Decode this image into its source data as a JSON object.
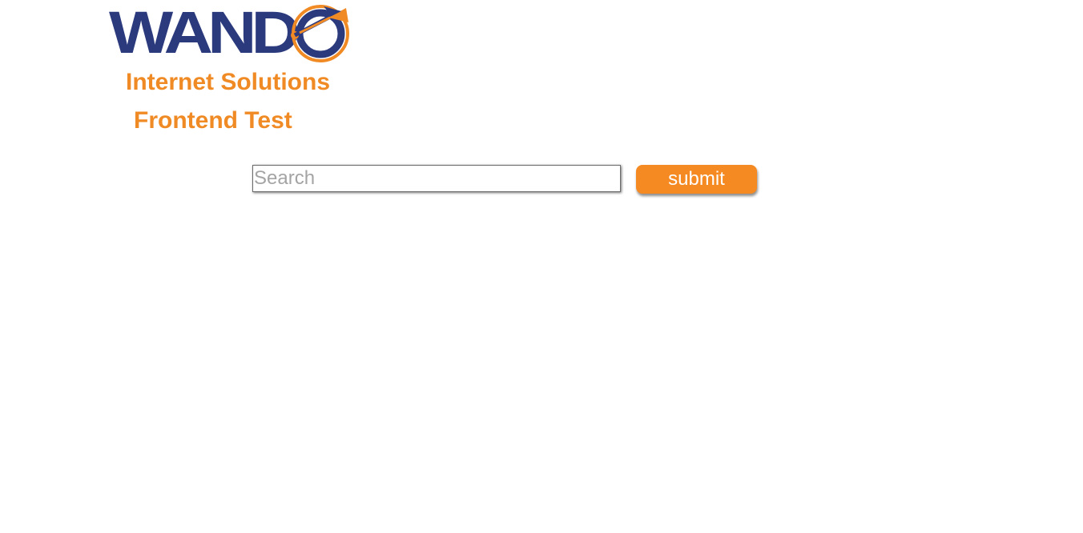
{
  "brand": {
    "logo_text": "WANDO",
    "tagline": "Internet Solutions",
    "colors": {
      "navy": "#2b3a7d",
      "orange": "#f08a24"
    }
  },
  "page": {
    "title": "Frontend Test"
  },
  "search": {
    "placeholder": "Search",
    "value": ""
  },
  "submit": {
    "label": "submit"
  },
  "icons": [
    "dart-target-icon"
  ]
}
